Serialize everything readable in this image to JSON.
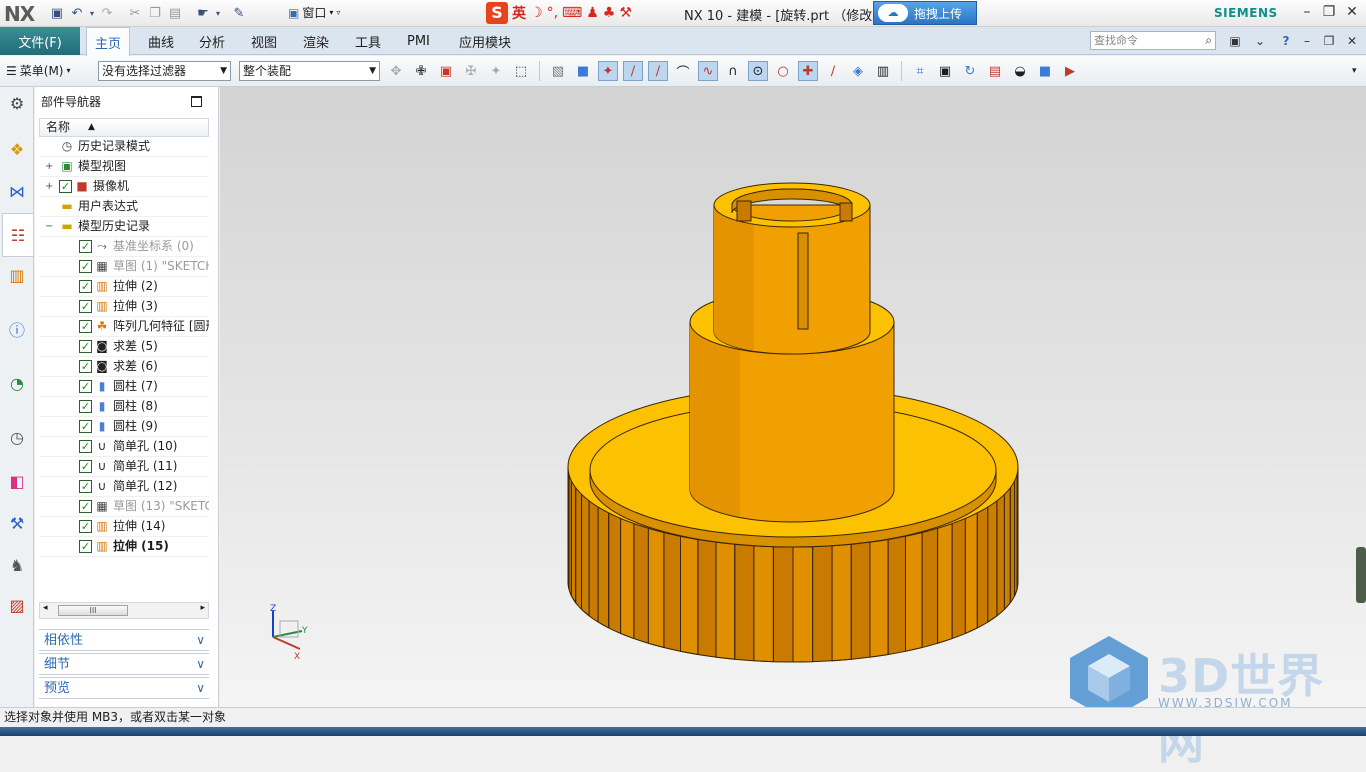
{
  "titlebar": {
    "logo": "NX",
    "window_menu": "窗口",
    "ime_label": "英",
    "title": "NX 10 - 建模 - [旋转.prt （修改的",
    "upload_button": "拖拽上传",
    "brand": "SIEMENS"
  },
  "ribbon": {
    "file_tab": "文件(F)",
    "tabs": [
      "主页",
      "曲线",
      "分析",
      "视图",
      "渲染",
      "工具",
      "PMI",
      "应用模块"
    ],
    "active_tab": "主页",
    "search_placeholder": "查找命令"
  },
  "toolbar": {
    "menu_label": "菜单(M)",
    "selection_filter": "没有选择过滤器",
    "assembly_scope": "整个装配"
  },
  "navigator": {
    "title": "部件导航器",
    "column_header": "名称",
    "nodes": [
      {
        "label": "历史记录模式",
        "icon": "clock-icon",
        "checked": false
      },
      {
        "label": "模型视图",
        "icon": "model-views-icon",
        "checked": false,
        "expander": "+"
      },
      {
        "label": "摄像机",
        "icon": "camera-icon",
        "checked": true,
        "expander": "+"
      },
      {
        "label": "用户表达式",
        "icon": "folder-icon",
        "checked": false
      },
      {
        "label": "模型历史记录",
        "icon": "folder-open-icon",
        "checked": false,
        "expander": "−"
      },
      {
        "label": "基准坐标系 (0)",
        "icon": "datum-csys-icon",
        "checked": true,
        "style": "gray"
      },
      {
        "label": "草图 (1) \"SKETCH",
        "icon": "sketch-icon",
        "checked": true,
        "style": "gray"
      },
      {
        "label": "拉伸 (2)",
        "icon": "extrude-icon",
        "checked": true
      },
      {
        "label": "拉伸 (3)",
        "icon": "extrude-icon",
        "checked": true
      },
      {
        "label": "阵列几何特征 [圆形",
        "icon": "pattern-icon",
        "checked": true
      },
      {
        "label": "求差 (5)",
        "icon": "subtract-icon",
        "checked": true
      },
      {
        "label": "求差 (6)",
        "icon": "subtract-icon",
        "checked": true
      },
      {
        "label": "圆柱 (7)",
        "icon": "cylinder-icon",
        "checked": true
      },
      {
        "label": "圆柱 (8)",
        "icon": "cylinder-icon",
        "checked": true
      },
      {
        "label": "圆柱 (9)",
        "icon": "cylinder-icon",
        "checked": true
      },
      {
        "label": "简单孔 (10)",
        "icon": "hole-icon",
        "checked": true
      },
      {
        "label": "简单孔 (11)",
        "icon": "hole-icon",
        "checked": true
      },
      {
        "label": "简单孔 (12)",
        "icon": "hole-icon",
        "checked": true
      },
      {
        "label": "草图 (13) \"SKETC",
        "icon": "sketch-icon",
        "checked": true,
        "style": "gray"
      },
      {
        "label": "拉伸 (14)",
        "icon": "extrude-icon",
        "checked": true
      },
      {
        "label": "拉伸 (15)",
        "icon": "extrude-icon",
        "checked": true,
        "style": "bold"
      }
    ],
    "scroll_thumb": "III",
    "panels": [
      "相依性",
      "细节",
      "预览"
    ]
  },
  "viewport": {
    "triad": {
      "z": "Z",
      "y": "Y",
      "x": "X"
    },
    "model_color": "#f0a000"
  },
  "watermark": {
    "text": "3D世界网",
    "url": "WWW.3DSJW.COM"
  },
  "status": {
    "message": "选择对象并使用 MB3，或者双击某一对象"
  }
}
